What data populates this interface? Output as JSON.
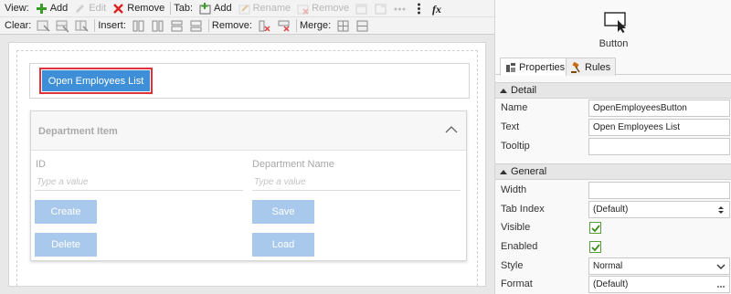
{
  "toolbar": {
    "view_label": "View:",
    "add_label": "Add",
    "edit_label": "Edit",
    "remove_label": "Remove",
    "tab_label": "Tab:",
    "tab_add_label": "Add",
    "rename_label": "Rename",
    "tab_remove_label": "Remove",
    "clear_label": "Clear:",
    "insert_label": "Insert:",
    "remove2_label": "Remove:",
    "merge_label": "Merge:"
  },
  "designer": {
    "open_button_label": "Open Employees List",
    "department_panel": {
      "title": "Department Item",
      "id_label": "ID",
      "id_placeholder": "Type a value",
      "name_label": "Department Name",
      "name_placeholder": "Type a value",
      "create_label": "Create",
      "save_label": "Save",
      "delete_label": "Delete",
      "load_label": "Load"
    }
  },
  "properties": {
    "control_type": "Button",
    "tabs": {
      "properties": "Properties",
      "rules": "Rules"
    },
    "detail_section": "Detail",
    "general_section": "General",
    "rows": {
      "name": {
        "label": "Name",
        "value": "OpenEmployeesButton"
      },
      "text": {
        "label": "Text",
        "value": "Open Employees List"
      },
      "tooltip": {
        "label": "Tooltip",
        "value": ""
      },
      "width": {
        "label": "Width",
        "value": ""
      },
      "tab_index": {
        "label": "Tab Index",
        "value": "(Default)"
      },
      "visible": {
        "label": "Visible",
        "checked": true
      },
      "enabled": {
        "label": "Enabled",
        "checked": true
      },
      "style": {
        "label": "Style",
        "value": "Normal"
      },
      "format": {
        "label": "Format",
        "value": "(Default)"
      }
    }
  },
  "colors": {
    "primary_button": "#3f8fd8",
    "selection_border": "#e0323c",
    "disabled_button": "#a9c9ec",
    "check_green": "#3c8a1e"
  }
}
